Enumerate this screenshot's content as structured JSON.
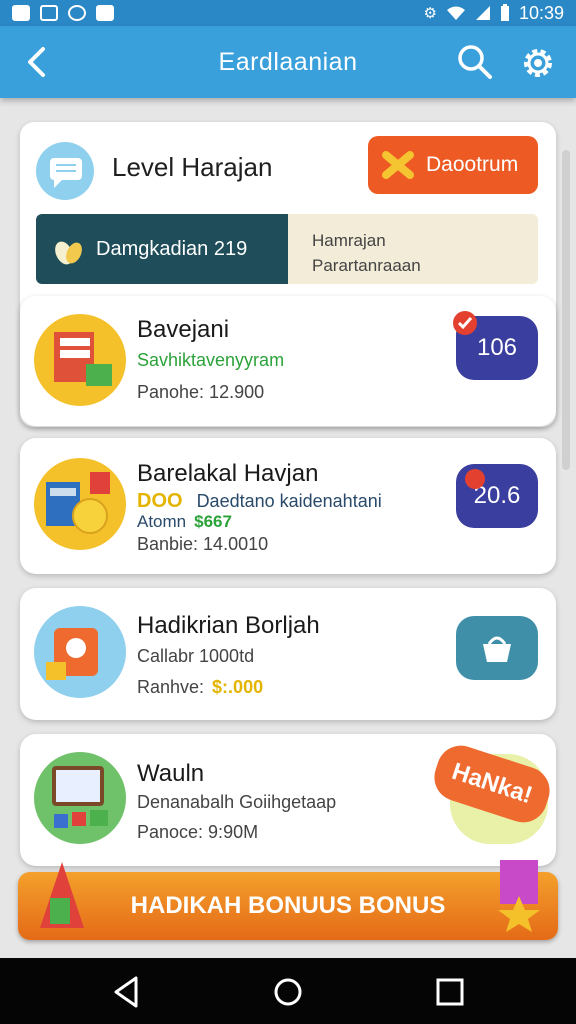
{
  "status_bar": {
    "time": "10:39"
  },
  "app_bar": {
    "title": "Eardlaanian"
  },
  "header_card": {
    "title": "Level Harajan",
    "action_button": "Daootrum",
    "banner_left": "Damgkadian 219",
    "banner_right_line1": "Hamrajan",
    "banner_right_line2": "Parartanraaan"
  },
  "items": [
    {
      "title": "Bavejani",
      "line1": "Savhiktavenyyram",
      "line2": "Panohe: 12.900",
      "badge": "106",
      "badge_color": "#3a3e9e"
    },
    {
      "title": "Barelakal Havjan",
      "tag": "DOO",
      "line1": "Daedtano kaidenahtani",
      "line2_prefix": "Atomn",
      "line2_value": "$667",
      "line3": "Banbie: 14.0010",
      "badge": "20.6",
      "badge_color": "#3a3e9e"
    },
    {
      "title": "Hadikrian Borljah",
      "line1": "Callabr 1000td",
      "line2_prefix": "Ranhve:",
      "line2_value": "$:.000",
      "badge_color": "#3f8fa8"
    },
    {
      "title": "Wauln",
      "line1": "Denanabalh Goiihgetaap",
      "line2": "Panoce: 9:90M",
      "sticker": "HaNka!"
    }
  ],
  "bonus_bar": {
    "label": "HADIKAH BONUUS BONUS"
  },
  "colors": {
    "appbar": "#3aa0dc",
    "status": "#2b88c6",
    "accent": "#ee5a24",
    "banner_dark": "#1f4e5a"
  }
}
